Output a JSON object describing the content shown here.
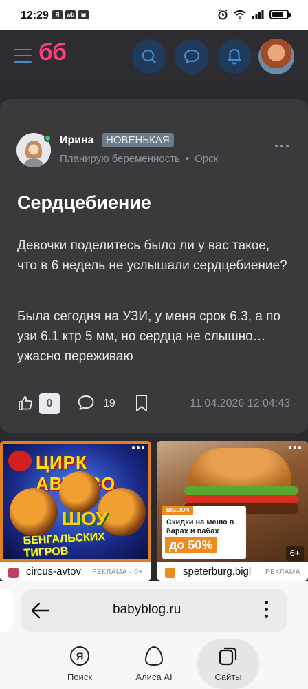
{
  "status_bar": {
    "time": "12:29",
    "left_icons": [
      "yandex-notif",
      "wb"
    ],
    "right_icons": [
      "alarm-icon",
      "wifi-icon",
      "signal-icon",
      "battery-icon"
    ],
    "battery_level": 0.8
  },
  "header": {
    "logo": "бб",
    "buttons": [
      "search-icon",
      "chat-icon",
      "bell-icon"
    ],
    "accent": "#ff3d7f",
    "icon_color": "#3d8fd6"
  },
  "post": {
    "author": {
      "name": "Ирина",
      "badge": "НОВЕНЬКАЯ",
      "status": "Планирую беременность",
      "city": "Орск",
      "separator": "•"
    },
    "title": "Сердцебиение",
    "paragraphs": [
      "Девочки поделитесь было ли у вас такое, что в 6 недель не услышали сердцебиение?",
      "Была сегодня на УЗИ, у меня срок 6.3, а по узи 6.1 ктр 5 мм, но сердца не слышно… ужасно переживаю"
    ],
    "likes": "0",
    "comments": "19",
    "date": "11.04.2026 12:04:43"
  },
  "ads": [
    {
      "headline": "ЦИРК АВТОВО",
      "show": "ШОУ",
      "subline": "БЕНГАЛЬСКИХ ТИГРОВ",
      "advertiser": "circus-avtov",
      "label": "РЕКЛАМА · 0+"
    },
    {
      "brand": "BIGLION",
      "promo_text": "Скидки на меню в барах и пабах",
      "promo_value": "до 50%",
      "age": "6+",
      "advertiser": "speterburg.bigl",
      "label": "РЕКЛАМА"
    }
  ],
  "browser": {
    "url": "babyblog.ru",
    "tabs": [
      {
        "label": "Поиск"
      },
      {
        "label": "Алиса AI"
      },
      {
        "label": "Сайты"
      }
    ]
  }
}
